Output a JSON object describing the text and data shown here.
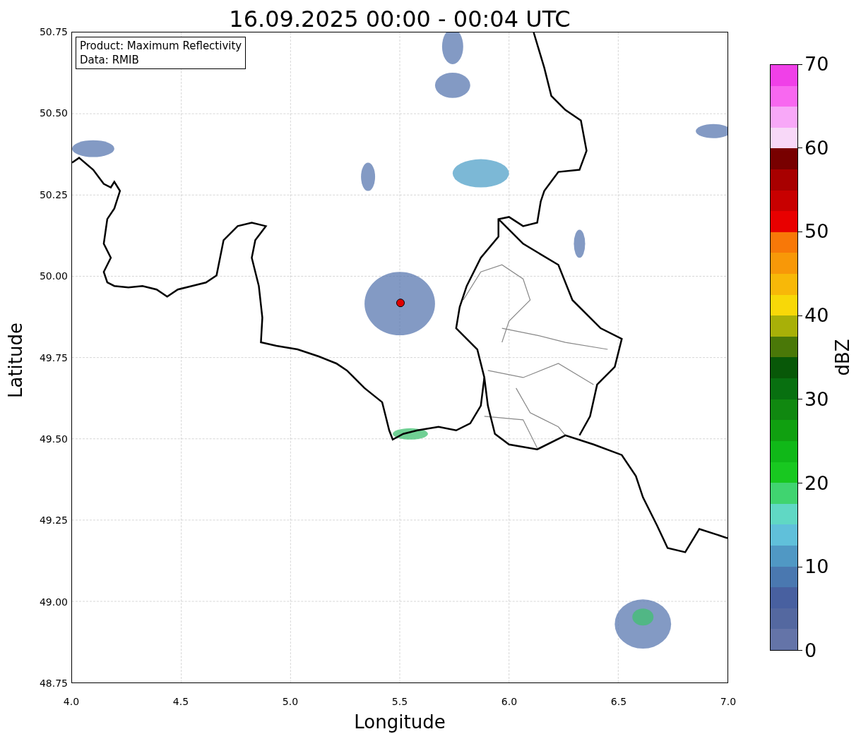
{
  "title": "16.09.2025 00:00 - 00:04 UTC",
  "legend": {
    "lines": [
      "Product: Maximum Reflectivity",
      "Data: RMIB"
    ]
  },
  "x_axis": {
    "label": "Longitude",
    "ticks": [
      "4.0",
      "4.5",
      "5.0",
      "5.5",
      "6.0",
      "6.5",
      "7.0"
    ]
  },
  "y_axis": {
    "label": "Latitude",
    "ticks": [
      "50.75",
      "50.50",
      "50.25",
      "50.00",
      "49.75",
      "49.50",
      "49.25",
      "49.00",
      "48.75"
    ]
  },
  "colorbar": {
    "label": "dBZ",
    "ticks": [
      "70",
      "60",
      "50",
      "40",
      "30",
      "20",
      "10",
      "0"
    ],
    "bands": [
      {
        "color": "#6474a8"
      },
      {
        "color": "#5468a0"
      },
      {
        "color": "#4860a0"
      },
      {
        "color": "#4a78b0"
      },
      {
        "color": "#5098c4"
      },
      {
        "color": "#60c0da"
      },
      {
        "color": "#60d8c4"
      },
      {
        "color": "#40d470"
      },
      {
        "color": "#18c820"
      },
      {
        "color": "#10b818"
      },
      {
        "color": "#10a010"
      },
      {
        "color": "#108810"
      },
      {
        "color": "#087010"
      },
      {
        "color": "#085808"
      },
      {
        "color": "#4a7808"
      },
      {
        "color": "#a8b008"
      },
      {
        "color": "#f8d808"
      },
      {
        "color": "#f8b808"
      },
      {
        "color": "#f89808"
      },
      {
        "color": "#f87808"
      },
      {
        "color": "#e80000"
      },
      {
        "color": "#c80000"
      },
      {
        "color": "#a80000"
      },
      {
        "color": "#780000"
      },
      {
        "color": "#f8d8f8"
      },
      {
        "color": "#f8a8f8"
      },
      {
        "color": "#f868f0"
      },
      {
        "color": "#f040e8"
      }
    ]
  }
}
